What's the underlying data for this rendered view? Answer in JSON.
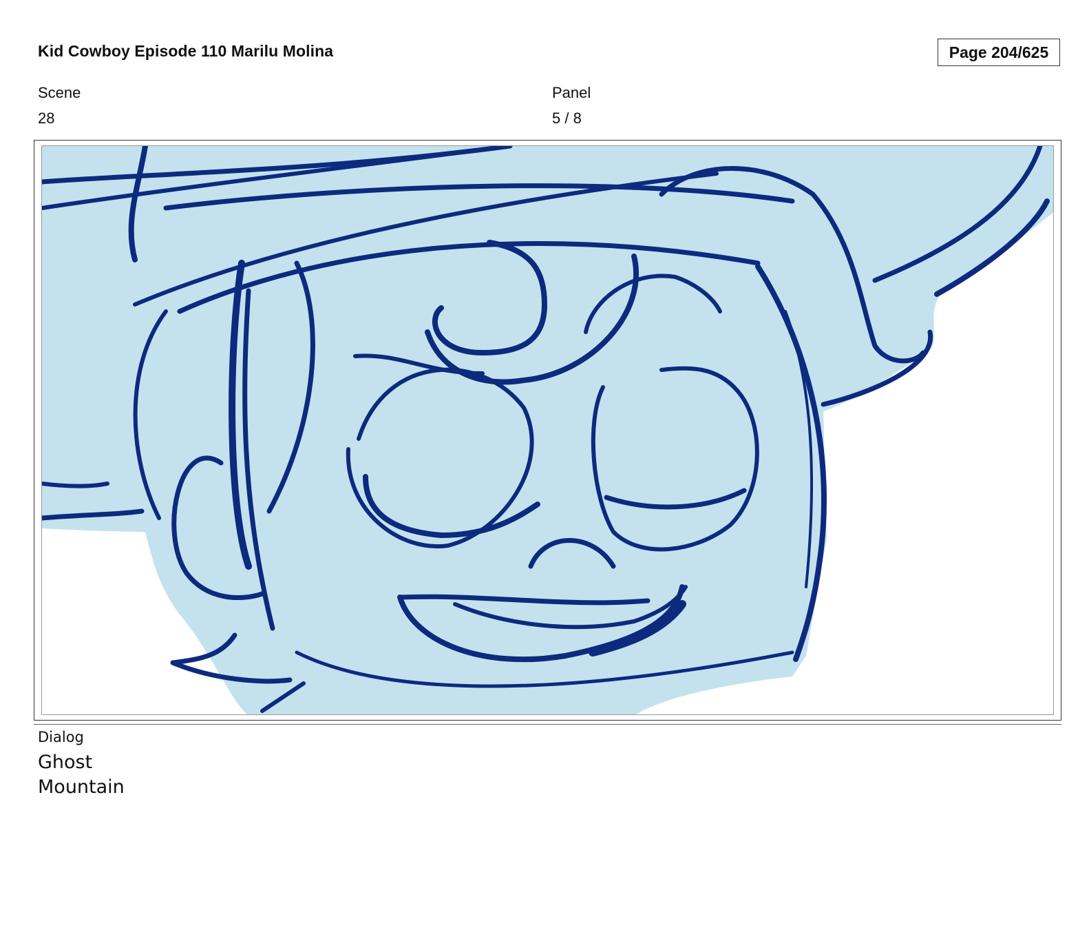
{
  "header": {
    "title": "Kid Cowboy Episode 110 Marilu Molina",
    "page": "Page 204/625"
  },
  "fields": {
    "scene_label": "Scene",
    "scene_value": "28",
    "panel_label": "Panel",
    "panel_value": "5 / 8"
  },
  "panel": {
    "sketch_subject": "character-face-closeup",
    "line_color": "#0d2a7e",
    "fill_color": "#c3e2ed"
  },
  "dialog": {
    "label": "Dialog",
    "lines": [
      "Ghost",
      "Mountain"
    ]
  }
}
